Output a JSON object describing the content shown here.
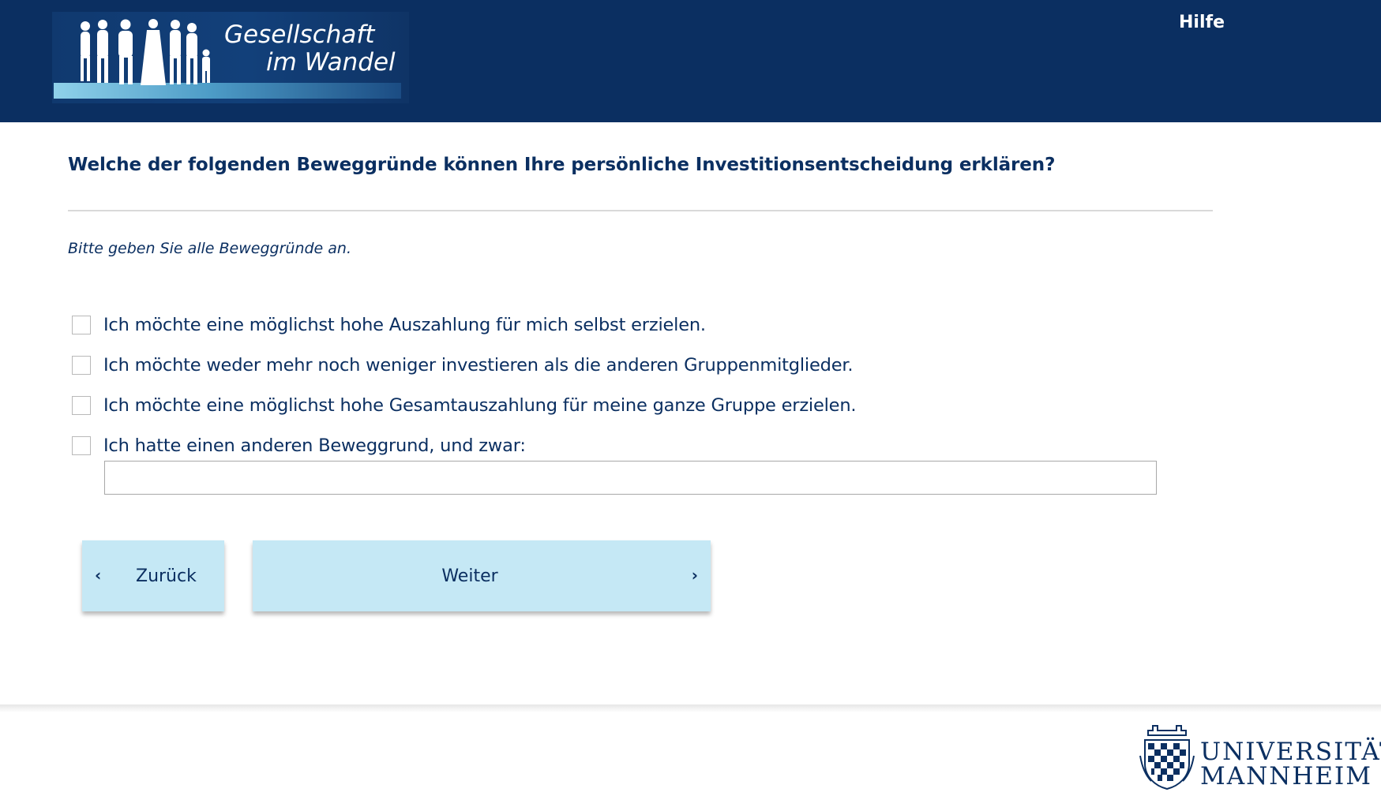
{
  "header": {
    "logo_line1": "Gesellschaft",
    "logo_line2": "im Wandel",
    "help_label": "Hilfe"
  },
  "question": {
    "title": "Welche der folgenden Beweggründe können Ihre persönliche Investitionsentscheidung erklären?",
    "instruction": "Bitte geben Sie alle Beweggründe an.",
    "options": [
      {
        "label": "Ich möchte eine möglichst hohe Auszahlung für mich selbst erzielen.",
        "checked": false
      },
      {
        "label": "Ich möchte weder mehr noch weniger investieren als die anderen Gruppenmitglieder.",
        "checked": false
      },
      {
        "label": "Ich möchte eine möglichst hohe Gesamtauszahlung für meine ganze Gruppe erzielen.",
        "checked": false
      },
      {
        "label": "Ich hatte einen anderen Beweggrund, und zwar:",
        "checked": false
      }
    ],
    "other_value": ""
  },
  "navigation": {
    "back_label": "Zurück",
    "next_label": "Weiter",
    "back_icon": "chevron-left-icon",
    "next_icon": "chevron-right-icon"
  },
  "footer": {
    "university_line1": "UNIVERSITÄT",
    "university_line2": "MANNHEIM"
  },
  "colors": {
    "header_bg": "#0b2f61",
    "primary_text": "#0b2f61",
    "button_bg": "#c5e8f5"
  }
}
